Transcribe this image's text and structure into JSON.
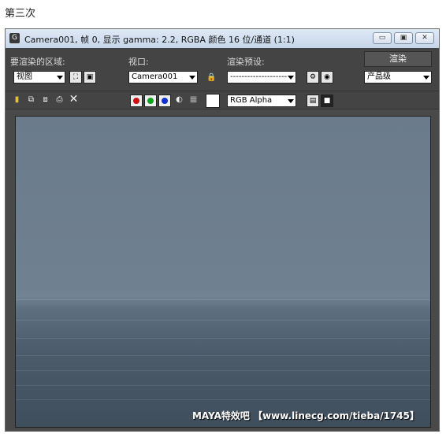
{
  "page_caption": "第三次",
  "window": {
    "title": "Camera001, 帧 0, 显示 gamma: 2.2, RGBA 颜色 16 位/通道 (1:1)",
    "controls": {
      "minimize": "▭",
      "maximize": "▣",
      "close": "✕"
    }
  },
  "panel": {
    "area_label": "要渲染的区域:",
    "area_value": "视图",
    "viewport_label": "视口:",
    "viewport_value": "Camera001",
    "preset_label": "渲染预设:",
    "preset_value": "--------------------",
    "render_button": "渲染",
    "quality_value": "产品级",
    "channel_value": "RGB Alpha"
  },
  "channel_colors": {
    "red": "#d01010",
    "green": "#10a020",
    "blue": "#1030d0"
  },
  "icons": [
    "save-icon",
    "copy-icon",
    "clone-icon",
    "print-icon",
    "clear-icon",
    "lock-icon",
    "mono-icon",
    "alpha-icon"
  ],
  "watermark": "MAYA特效吧 【www.linecg.com/tieba/1745】"
}
